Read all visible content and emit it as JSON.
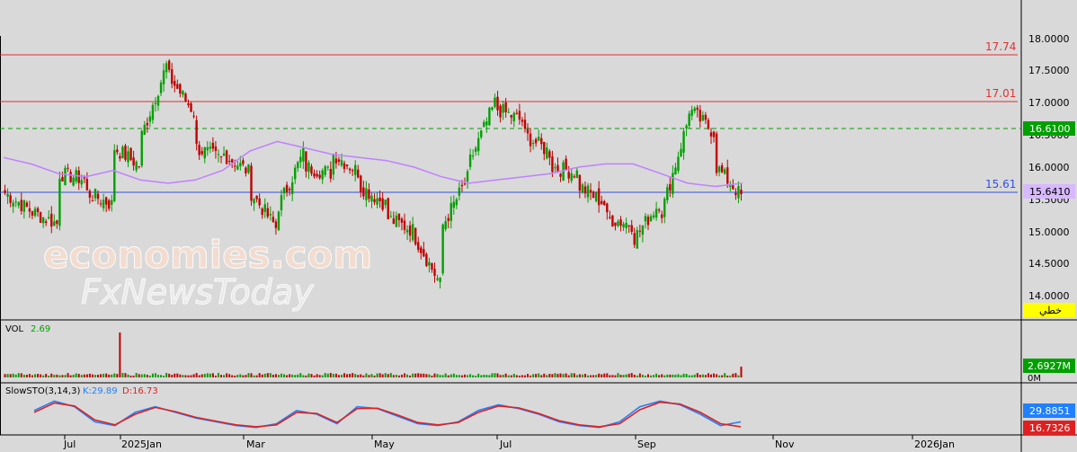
{
  "colors": {
    "background": "#d9d9d9",
    "up": "#00a000",
    "down": "#c00000",
    "ma": "#c080ff",
    "resistance": "#e03030",
    "support": "#3050e0",
    "last_price": "#00a000",
    "k_line": "#2080ff",
    "d_line": "#e02020"
  },
  "main_panel": {
    "price_ticks": [
      "18.0000",
      "17.5000",
      "17.0000",
      "16.5000",
      "16.0000",
      "15.5000",
      "15.0000",
      "14.5000",
      "14.0000"
    ],
    "levels": [
      {
        "label": "17.74",
        "value": 17.74,
        "kind": "resistance"
      },
      {
        "label": "17.01",
        "value": 17.01,
        "kind": "resistance"
      },
      {
        "label": "15.61",
        "value": 15.61,
        "kind": "support"
      }
    ],
    "last_price_label": "16.6100",
    "ma_value_label": "15.6410",
    "ma_value": 15.641,
    "yellow_tag": "خطي",
    "watermark_line1": "economies.com",
    "watermark_line2": "FxNewsToday"
  },
  "vol_panel": {
    "title": "VOL",
    "value": "2.69",
    "last_label": "2.6927M",
    "axis_label": "0M"
  },
  "sto_panel": {
    "title": "SlowSTO(3,14,3)",
    "k_label": "K:29.89",
    "d_label": "D:16.73",
    "k_value_label": "29.8851",
    "d_value_label": "16.7326",
    "k_value": 29.89,
    "d_value": 16.73
  },
  "x_axis": {
    "labels": [
      "Jul",
      "2025Jan",
      "Mar",
      "May",
      "Jul",
      "Sep",
      "Nov",
      "2026Jan"
    ]
  },
  "chart_data": {
    "type": "candlestick",
    "title": "",
    "ylim": [
      13.85,
      18.1
    ],
    "grid": false,
    "x_labels": [
      "Jul",
      "2025Jan",
      "Mar",
      "May",
      "Jul",
      "Sep",
      "Nov",
      "2026Jan"
    ],
    "segments": [
      [
        15.6,
        15.3,
        15.2
      ],
      [
        15.3,
        15.1,
        15.9
      ],
      [
        15.9,
        15.8,
        15.6
      ],
      [
        15.6,
        15.4,
        15.2
      ],
      [
        16.3,
        16.0,
        16.5
      ],
      [
        16.5,
        17.7,
        17.4
      ],
      [
        17.4,
        16.8,
        16.3
      ],
      [
        16.3,
        16.1,
        16.2
      ],
      [
        16.2,
        15.9,
        15.6
      ],
      [
        15.6,
        15.0,
        15.4
      ],
      [
        15.4,
        16.3,
        16.0
      ],
      [
        16.0,
        15.9,
        16.2
      ],
      [
        16.2,
        15.9,
        15.7
      ],
      [
        15.7,
        15.4,
        15.2
      ],
      [
        15.2,
        15.0,
        14.9
      ],
      [
        14.9,
        14.1,
        15.1
      ],
      [
        15.1,
        15.9,
        16.1
      ],
      [
        16.1,
        17.1,
        16.9
      ],
      [
        16.9,
        16.7,
        16.5
      ],
      [
        16.5,
        16.2,
        16.0
      ],
      [
        16.0,
        15.9,
        15.7
      ],
      [
        15.7,
        15.4,
        15.2
      ],
      [
        15.2,
        15.1,
        14.9
      ],
      [
        14.9,
        15.5,
        15.3
      ],
      [
        15.3,
        16.8,
        16.9
      ],
      [
        16.9,
        16.5,
        16.0
      ],
      [
        16.0,
        15.5,
        15.2
      ]
    ],
    "ma_series": [
      16.15,
      16.05,
      15.9,
      15.85,
      15.95,
      15.8,
      15.75,
      15.8,
      15.95,
      16.25,
      16.4,
      16.3,
      16.2,
      16.15,
      16.1,
      16.0,
      15.85,
      15.75,
      15.8,
      15.85,
      15.9,
      16.0,
      16.05,
      16.05,
      15.9,
      15.75,
      15.7,
      15.75
    ],
    "volume": {
      "last": 2.69,
      "unit": "M",
      "spike_ratio": 0.55
    },
    "stochastic_k": [
      60,
      85,
      70,
      30,
      20,
      55,
      70,
      55,
      40,
      30,
      20,
      15,
      25,
      60,
      50,
      25,
      70,
      65,
      45,
      25,
      20,
      30,
      60,
      75,
      65,
      50,
      30,
      20,
      15,
      30,
      70,
      85,
      75,
      50,
      20,
      30
    ],
    "stochastic_d": [
      55,
      80,
      72,
      35,
      22,
      50,
      68,
      57,
      42,
      32,
      22,
      17,
      22,
      55,
      52,
      28,
      65,
      66,
      48,
      28,
      22,
      28,
      55,
      72,
      67,
      52,
      33,
      22,
      17,
      25,
      62,
      82,
      77,
      55,
      25,
      17
    ]
  }
}
